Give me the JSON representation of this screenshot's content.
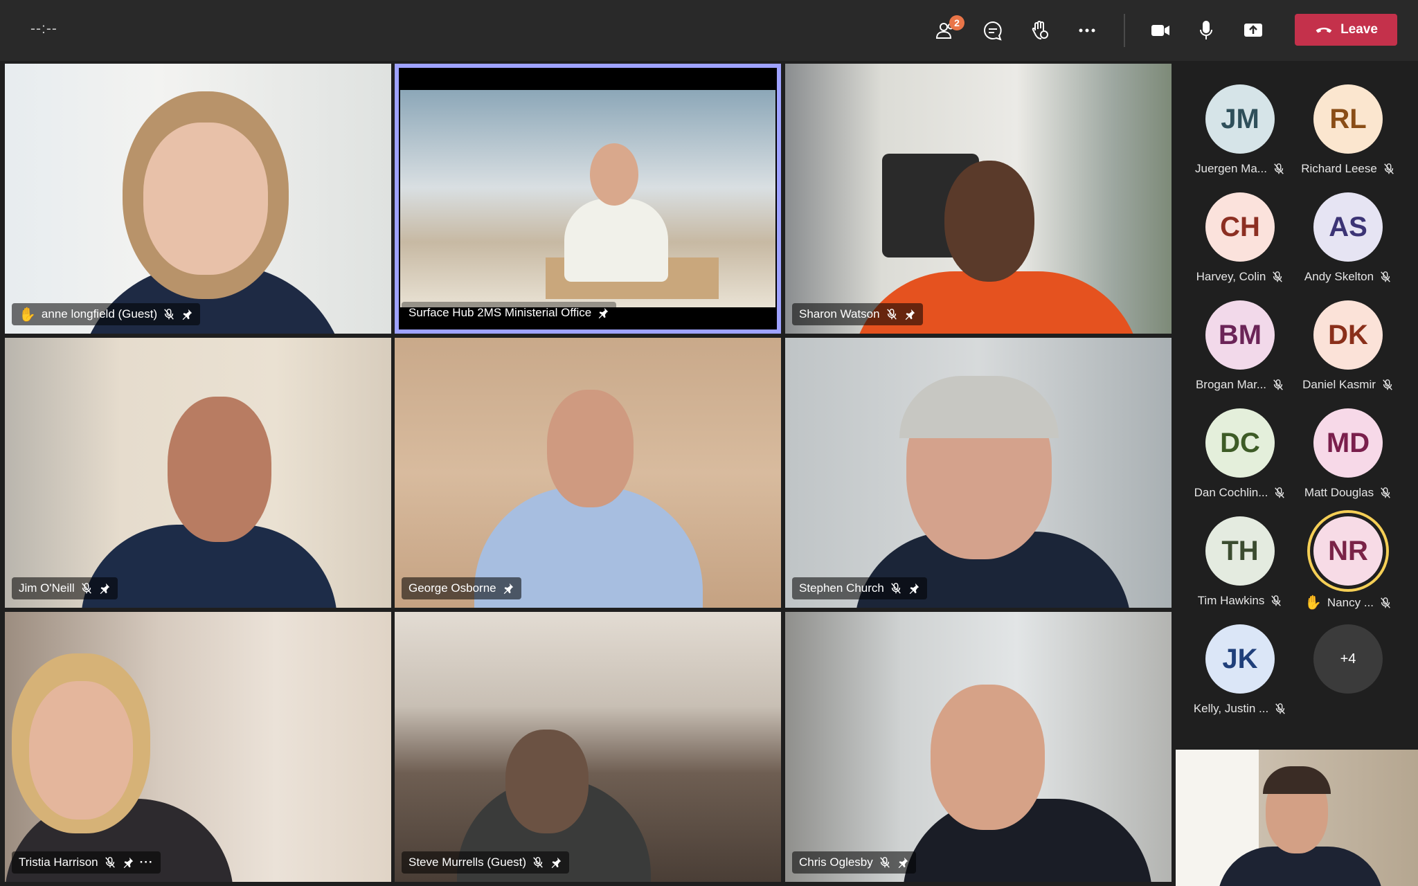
{
  "toolbar": {
    "timer": "--:--",
    "participants_badge": "2",
    "leave_label": "Leave"
  },
  "tiles": [
    {
      "name": "anne longfield (Guest)",
      "hand_raised": true,
      "muted": true,
      "pinned": true,
      "state": "speaking"
    },
    {
      "name": "Surface Hub 2MS Ministerial Office",
      "muted": false,
      "pinned": true,
      "state": "pinned-view"
    },
    {
      "name": "Sharon Watson",
      "muted": true,
      "pinned": true
    },
    {
      "name": "Jim O'Neill",
      "muted": true,
      "pinned": true
    },
    {
      "name": "George Osborne",
      "muted": false,
      "pinned": true
    },
    {
      "name": "Stephen Church",
      "muted": true,
      "pinned": true
    },
    {
      "name": "Tristia Harrison",
      "muted": true,
      "pinned": true,
      "more": "···"
    },
    {
      "name": "Steve Murrells (Guest)",
      "muted": true,
      "pinned": true
    },
    {
      "name": "Chris Oglesby",
      "muted": true,
      "pinned": true
    }
  ],
  "participants": [
    {
      "initials": "JM",
      "name": "Juergen Ma...",
      "bg": "#d6e4e8",
      "fg": "#2f4f5a"
    },
    {
      "initials": "RL",
      "name": "Richard Leese",
      "bg": "#fbe6cf",
      "fg": "#8a4d16"
    },
    {
      "initials": "CH",
      "name": "Harvey, Colin",
      "bg": "#fbe2dc",
      "fg": "#8c2f22"
    },
    {
      "initials": "AS",
      "name": "Andy Skelton",
      "bg": "#e6e4f3",
      "fg": "#3c3475"
    },
    {
      "initials": "BM",
      "name": "Brogan Mar...",
      "bg": "#f2d9ea",
      "fg": "#6b2457"
    },
    {
      "initials": "DK",
      "name": "Daniel Kasmir",
      "bg": "#fbe2d8",
      "fg": "#8a2f1a"
    },
    {
      "initials": "DC",
      "name": "Dan Cochlin...",
      "bg": "#e4efdb",
      "fg": "#3d5b26"
    },
    {
      "initials": "MD",
      "name": "Matt Douglas",
      "bg": "#f7d9e8",
      "fg": "#7a1f4c"
    },
    {
      "initials": "TH",
      "name": "Tim Hawkins",
      "bg": "#e4ebe0",
      "fg": "#3b4c30"
    },
    {
      "initials": "NR",
      "name": "Nancy ...",
      "bg": "#f7dbe6",
      "fg": "#7a2347",
      "speaking": true,
      "hand_raised": true
    },
    {
      "initials": "JK",
      "name": "Kelly, Justin ...",
      "bg": "#dbe6f7",
      "fg": "#1f3f7a"
    }
  ],
  "overflow_count": "+4",
  "colors": {
    "speaking_border": "#f5cf56",
    "pinned_border": "#9ea2ff",
    "leave": "#c4314b",
    "badge": "#e97548"
  }
}
